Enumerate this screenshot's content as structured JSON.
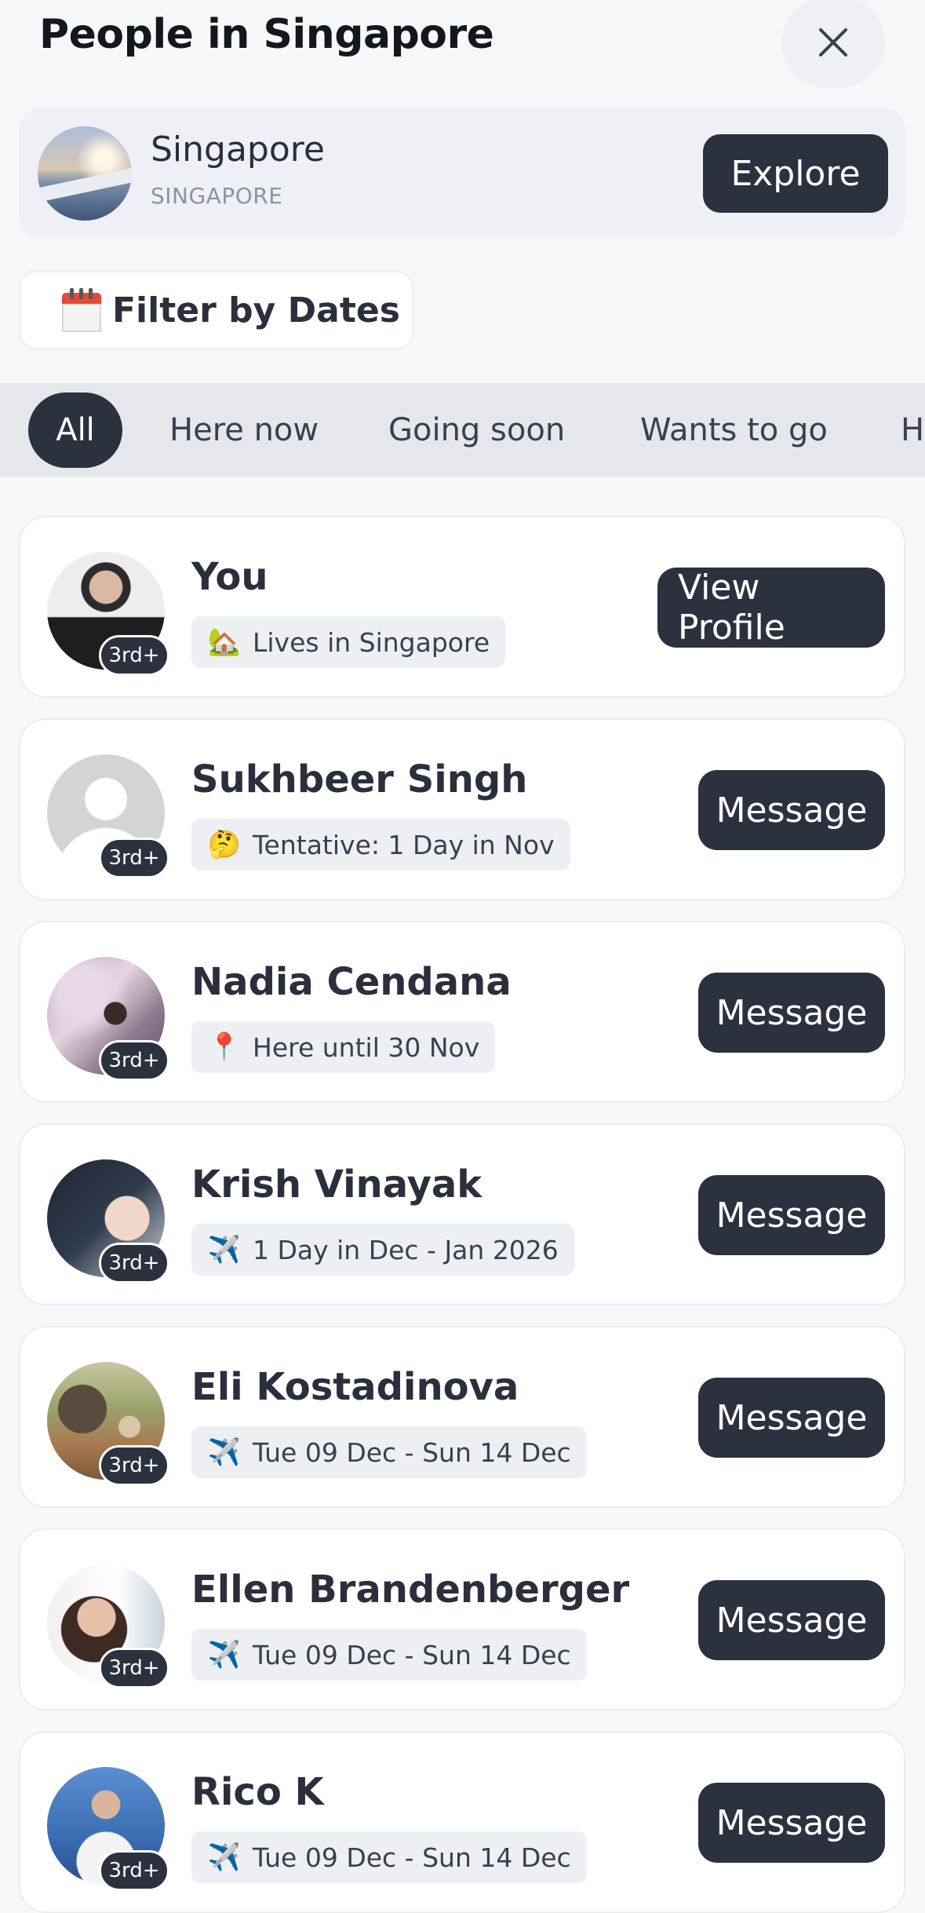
{
  "header": {
    "title": "People in Singapore"
  },
  "location": {
    "name": "Singapore",
    "country": "SINGAPORE",
    "explore_label": "Explore"
  },
  "filter": {
    "label": "Filter by Dates"
  },
  "tabs": [
    {
      "label": "All"
    },
    {
      "label": "Here now"
    },
    {
      "label": "Going soon"
    },
    {
      "label": "Wants to go"
    },
    {
      "label": "H"
    }
  ],
  "people": [
    {
      "name": "You",
      "status_icon": "house-icon",
      "status": "Lives in Singapore",
      "badge": "3rd+",
      "action": "View Profile"
    },
    {
      "name": "Sukhbeer Singh",
      "status_icon": "thinking-face-icon",
      "status": "Tentative: 1 Day in Nov",
      "badge": "3rd+",
      "action": "Message"
    },
    {
      "name": "Nadia Cendana",
      "status_icon": "pin-icon",
      "status": "Here until 30 Nov",
      "badge": "3rd+",
      "action": "Message"
    },
    {
      "name": "Krish Vinayak",
      "status_icon": "airplane-icon",
      "status": "1 Day in Dec - Jan 2026",
      "badge": "3rd+",
      "action": "Message"
    },
    {
      "name": "Eli Kostadinova",
      "status_icon": "airplane-icon",
      "status": "Tue 09 Dec - Sun 14 Dec",
      "badge": "3rd+",
      "action": "Message"
    },
    {
      "name": "Ellen Brandenberger",
      "status_icon": "airplane-icon",
      "status": "Tue 09 Dec - Sun 14 Dec",
      "badge": "3rd+",
      "action": "Message"
    },
    {
      "name": "Rico K",
      "status_icon": "airplane-icon",
      "status": "Tue 09 Dec - Sun 14 Dec",
      "badge": "3rd+",
      "action": "Message"
    }
  ]
}
